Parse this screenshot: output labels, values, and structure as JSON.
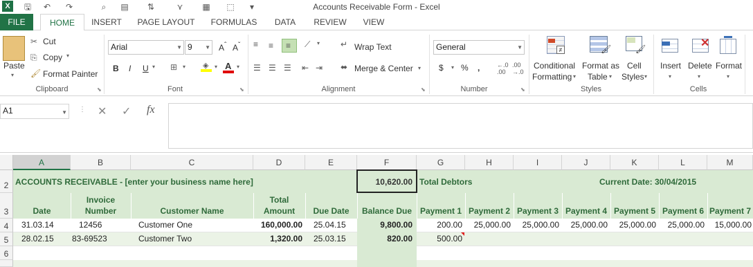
{
  "window": {
    "title": "Accounts Receivable Form - Excel"
  },
  "tabs": [
    "FILE",
    "HOME",
    "INSERT",
    "PAGE LAYOUT",
    "FORMULAS",
    "DATA",
    "REVIEW",
    "VIEW"
  ],
  "ribbon": {
    "clipboard": {
      "paste": "Paste",
      "cut": "Cut",
      "copy": "Copy",
      "format_painter": "Format Painter",
      "label": "Clipboard"
    },
    "font": {
      "name": "Arial",
      "size": "9",
      "label": "Font",
      "bold": "B",
      "italic": "I",
      "underline": "U"
    },
    "alignment": {
      "wrap": "Wrap Text",
      "merge": "Merge & Center",
      "label": "Alignment"
    },
    "number": {
      "format": "General",
      "currency": "$",
      "percent": "%",
      "comma": ",",
      "inc": ".00 →.0",
      "label": "Number"
    },
    "styles": {
      "cond1": "Conditional",
      "cond2": "Formatting",
      "fmt1": "Format as",
      "fmt2": "Table",
      "cell1": "Cell",
      "cell2": "Styles",
      "label": "Styles"
    },
    "cells": {
      "insert": "Insert",
      "delete": "Delete",
      "format": "Format",
      "label": "Cells"
    }
  },
  "formula_bar": {
    "name_box": "A1",
    "fx": "fx",
    "cancel": "✕",
    "enter": "✓",
    "content": ""
  },
  "columns": [
    "A",
    "B",
    "C",
    "D",
    "E",
    "F",
    "G",
    "H",
    "I",
    "J",
    "K",
    "L",
    "M"
  ],
  "rows": [
    "2",
    "3",
    "4",
    "5",
    "6"
  ],
  "sheet": {
    "title": "ACCOUNTS RECEIVABLE - [enter your business name here]",
    "total_value": "10,620.00",
    "total_label": "Total Debtors",
    "current_date": "Current Date: 30/04/2015",
    "headers": {
      "date": "Date",
      "invoice1": "Invoice",
      "invoice2": "Number",
      "customer": "Customer Name",
      "total1": "Total",
      "total2": "Amount",
      "due": "Due Date",
      "balance": "Balance Due",
      "p1": "Payment 1",
      "p2": "Payment 2",
      "p3": "Payment 3",
      "p4": "Payment 4",
      "p5": "Payment 5",
      "p6": "Payment 6",
      "p7": "Payment 7"
    },
    "records": [
      {
        "date": "31.03.14",
        "invoice": "12456",
        "customer": "Customer One",
        "total": "160,000.00",
        "due": "25.04.15",
        "balance": "9,800.00",
        "p1": "200.00",
        "p2": "25,000.00",
        "p3": "25,000.00",
        "p4": "25,000.00",
        "p5": "25,000.00",
        "p6": "25,000.00",
        "p7": "15,000.00"
      },
      {
        "date": "28.02.15",
        "invoice": "83-69523",
        "customer": "Customer Two",
        "total": "1,320.00",
        "due": "25.03.15",
        "balance": "820.00",
        "p1": "500.00",
        "p2": "",
        "p3": "",
        "p4": "",
        "p5": "",
        "p6": "",
        "p7": ""
      }
    ]
  },
  "colors": {
    "accent": "#217346",
    "header_fill": "#d9ead3",
    "header_text": "#2f6a3a"
  }
}
